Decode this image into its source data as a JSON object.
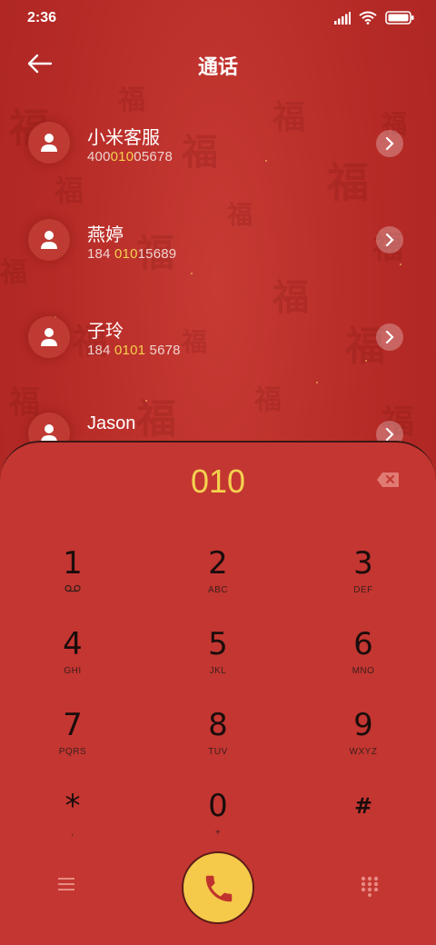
{
  "status_bar": {
    "time": "2:36"
  },
  "header": {
    "title": "通话"
  },
  "contacts": [
    {
      "name": "小米客服",
      "number_pre": "400",
      "number_match": "010",
      "number_post": "05678"
    },
    {
      "name": "燕婷",
      "number_pre": "184 ",
      "number_match": "010",
      "number_post": "15689"
    },
    {
      "name": "子玲",
      "number_pre": "184 ",
      "number_match": "0101",
      "number_post": " 5678"
    },
    {
      "name": "Jason",
      "number_pre": "",
      "number_match": "",
      "number_post": ""
    }
  ],
  "dialpad": {
    "entered": "010",
    "keys": [
      {
        "digit": "1",
        "letters": ""
      },
      {
        "digit": "2",
        "letters": "ABC"
      },
      {
        "digit": "3",
        "letters": "DEF"
      },
      {
        "digit": "4",
        "letters": "GHI"
      },
      {
        "digit": "5",
        "letters": "JKL"
      },
      {
        "digit": "6",
        "letters": "MNO"
      },
      {
        "digit": "7",
        "letters": "PQRS"
      },
      {
        "digit": "8",
        "letters": "TUV"
      },
      {
        "digit": "9",
        "letters": "WXYZ"
      },
      {
        "digit": "*",
        "letters": ","
      },
      {
        "digit": "0",
        "letters": "+"
      },
      {
        "digit": "#",
        "letters": ""
      }
    ]
  },
  "icons": {
    "back": "arrow-left-icon",
    "voicemail": "voicemail-icon",
    "backspace": "backspace-icon",
    "menu": "menu-icon",
    "call": "phone-icon",
    "keypad": "keypad-icon"
  },
  "colors": {
    "background": "#b52a26",
    "panel": "#c43631",
    "highlight": "#f4d14f",
    "call_button": "#f5c94a"
  }
}
